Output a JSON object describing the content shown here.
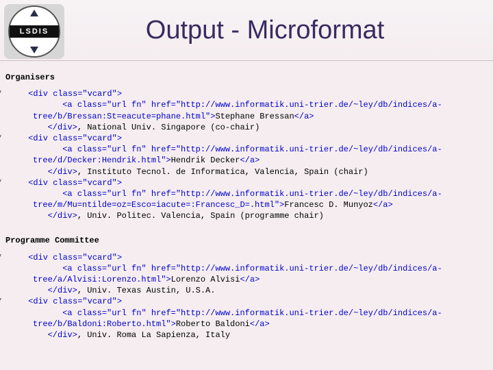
{
  "header": {
    "logo_text": "LSDIS",
    "title": "Output - Microformat"
  },
  "sections": [
    {
      "heading": "Organisers",
      "items": [
        {
          "open": "<div class=\"vcard\">",
          "link_open": "<a class=\"url fn\" href=\"http://www.informatik.uni-trier.de/~ley/db/indices/a-tree/b/Bressan:St=eacute=phane.html\">",
          "name": "Stephane Bressan",
          "link_close": "</a>",
          "close": "</div>",
          "suffix": ", National Univ. Singapore (co-chair)"
        },
        {
          "open": "<div class=\"vcard\">",
          "link_open": "<a class=\"url fn\" href=\"http://www.informatik.uni-trier.de/~ley/db/indices/a-tree/d/Decker:Hendrik.html\">",
          "name": "Hendrik Decker",
          "link_close": "</a>",
          "close": "</div>",
          "suffix": ", Instituto Tecnol. de Informatica, Valencia, Spain (chair)"
        },
        {
          "open": "<div class=\"vcard\">",
          "link_open": "<a class=\"url fn\" href=\"http://www.informatik.uni-trier.de/~ley/db/indices/a-tree/m/Mu=ntilde=oz=Esco=iacute=:Francesc_D=.html\">",
          "name": "Francesc D. Munyoz",
          "link_close": "</a>",
          "close": "</div>",
          "suffix": ", Univ. Politec. Valencia, Spain (programme chair)"
        }
      ]
    },
    {
      "heading": "Programme Committee",
      "items": [
        {
          "open": "<div class=\"vcard\">",
          "link_open": "<a class=\"url fn\" href=\"http://www.informatik.uni-trier.de/~ley/db/indices/a-tree/a/Alvisi:Lorenzo.html\">",
          "name": "Lorenzo Alvisi",
          "link_close": "</a>",
          "close": "</div>",
          "suffix": ", Univ. Texas Austin, U.S.A."
        },
        {
          "open": "<div class=\"vcard\">",
          "link_open": "<a class=\"url fn\" href=\"http://www.informatik.uni-trier.de/~ley/db/indices/a-tree/b/Baldoni:Roberto.html\">",
          "name": "Roberto Baldoni",
          "link_close": "</a>",
          "close": "</div>",
          "suffix": ", Univ. Roma La Sapienza, Italy"
        }
      ]
    }
  ]
}
